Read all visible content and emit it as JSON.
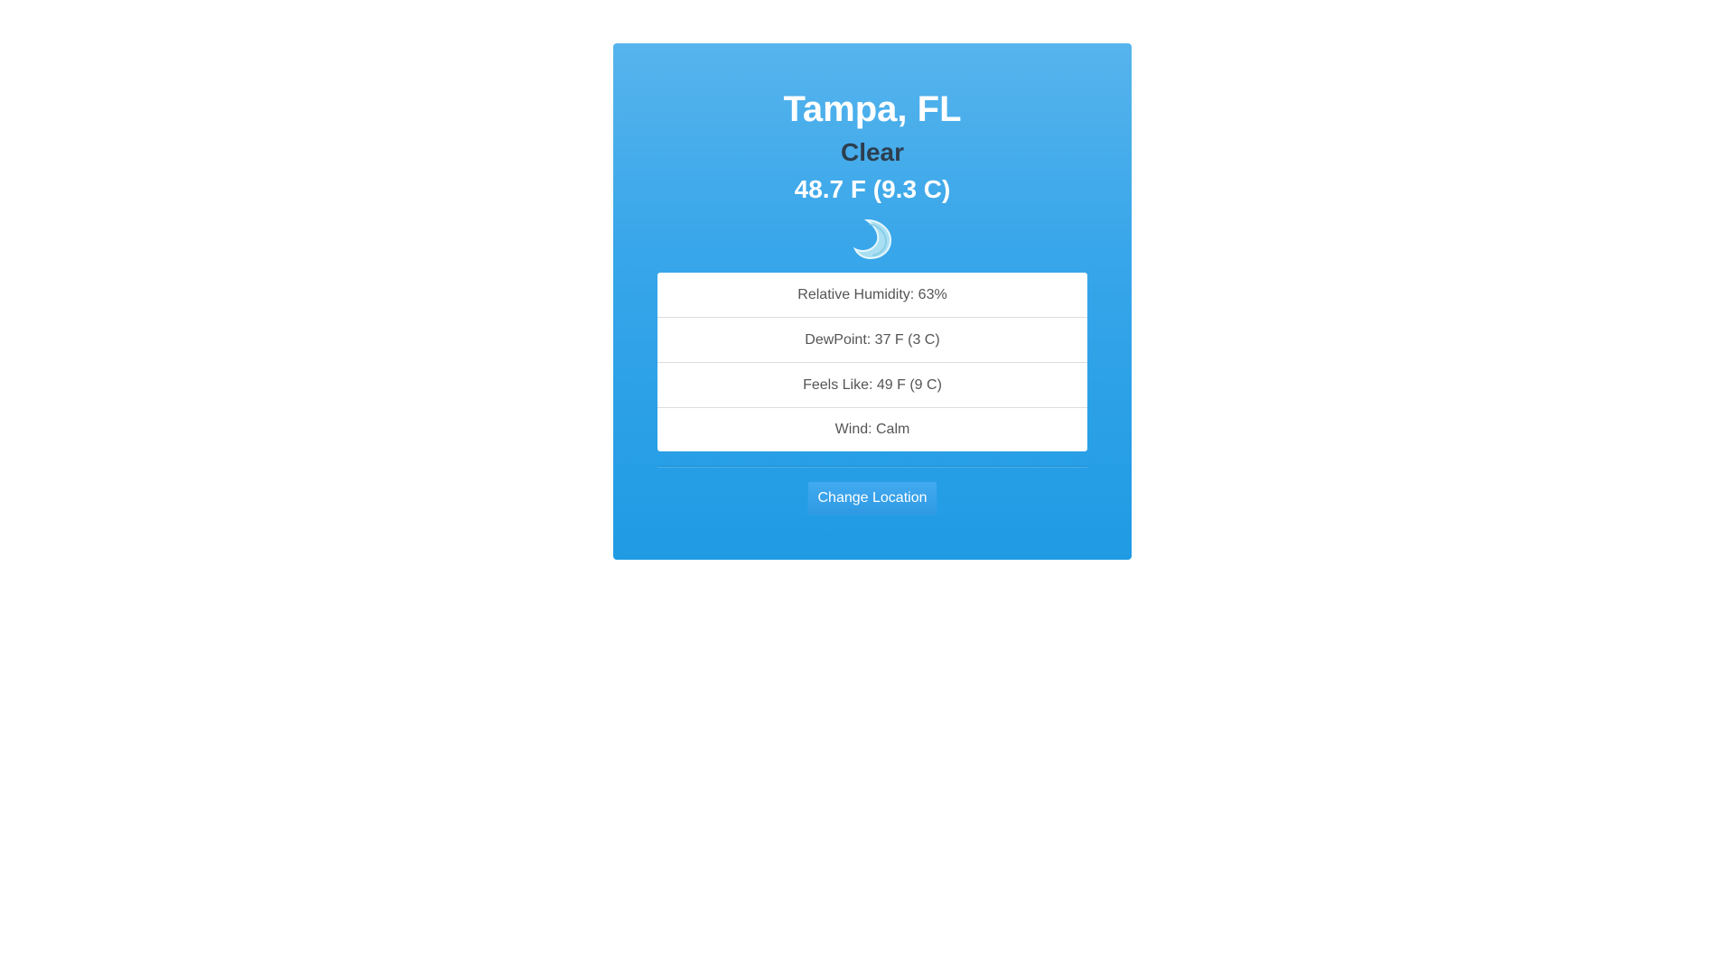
{
  "location": {
    "city": "Tampa, FL"
  },
  "current": {
    "condition": "Clear",
    "temperature": "48.7 F (9.3 C)",
    "icon": "crescent-moon-icon"
  },
  "details": [
    {
      "label": "Relative Humidity: 63%"
    },
    {
      "label": "DewPoint: 37 F (3 C)"
    },
    {
      "label": "Feels Like: 49 F (9 C)"
    },
    {
      "label": "Wind: Calm"
    }
  ],
  "actions": {
    "change_location_label": "Change Location"
  },
  "colors": {
    "card_gradient_top": "#56b4ec",
    "card_gradient_bottom": "#1f9be4",
    "condition_text": "#2d3e4e",
    "moon": "#a9dff2"
  }
}
